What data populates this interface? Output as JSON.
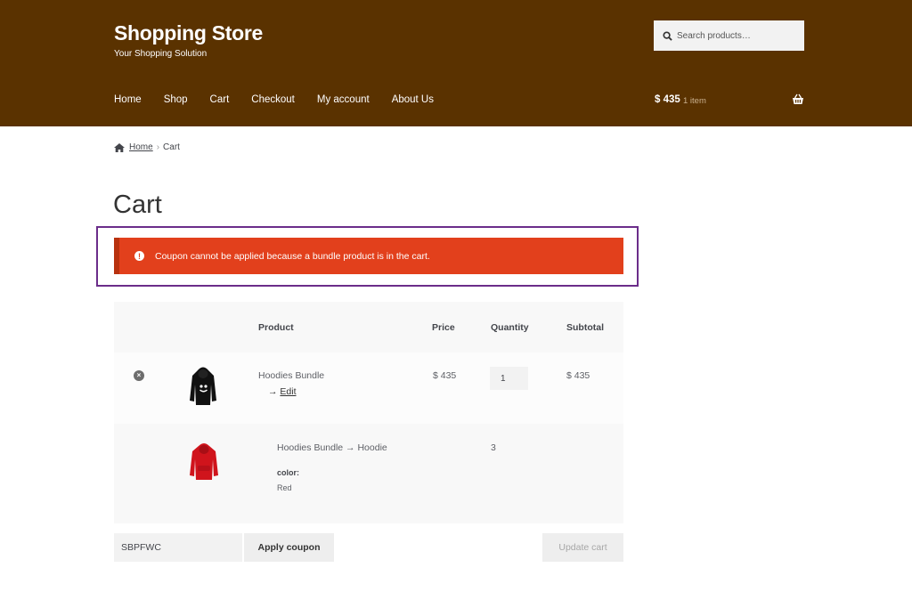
{
  "header": {
    "site_title": "Shopping Store",
    "tagline": "Your Shopping Solution",
    "search_placeholder": "Search products…",
    "nav": [
      "Home",
      "Shop",
      "Cart",
      "Checkout",
      "My account",
      "About Us"
    ],
    "cart_total": "$ 435",
    "cart_count": "1 item",
    "colors": {
      "header_bg": "#5a3200",
      "notice_bg": "#e2401c",
      "focus_outline": "#6b2d8a"
    }
  },
  "breadcrumb": {
    "home": "Home",
    "separator": "›",
    "current": "Cart"
  },
  "page_title": "Cart",
  "notice": {
    "icon": "exclamation-circle-icon",
    "text": "Coupon cannot be applied because a bundle product is in the cart."
  },
  "table": {
    "headers": {
      "product": "Product",
      "price": "Price",
      "quantity": "Quantity",
      "subtotal": "Subtotal"
    },
    "bundle": {
      "name": "Hoodies Bundle",
      "edit_arrow": "→",
      "edit_label": "Edit",
      "price": "$ 435",
      "quantity": "1",
      "subtotal": "$ 435",
      "image": "black-hoodie-image"
    },
    "bundled_item": {
      "name": "Hoodies Bundle → Hoodie",
      "quantity": "3",
      "attribute_label": "color:",
      "attribute_value": "Red",
      "image": "red-hoodie-image"
    }
  },
  "actions": {
    "coupon_value": "SBPFWC",
    "apply_label": "Apply coupon",
    "update_label": "Update cart"
  }
}
